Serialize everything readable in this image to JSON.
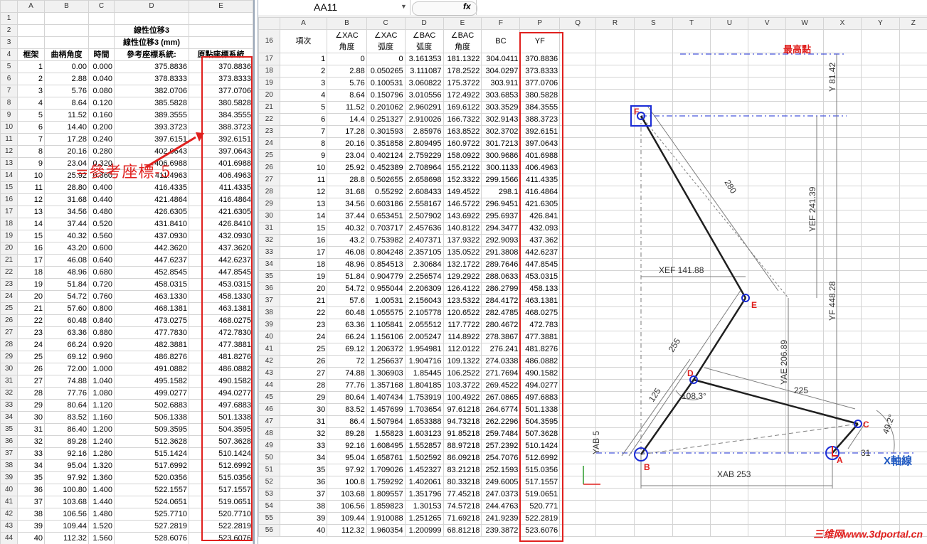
{
  "left_sheet": {
    "col_headers": [
      "A",
      "B",
      "C",
      "D",
      "E"
    ],
    "title1": "線性位移3",
    "title2": "線性位移3 (mm)",
    "headers": [
      "框架",
      "曲柄角度",
      "時間",
      "參考座標系統:",
      "原點座標系統"
    ],
    "row_numbers": [
      "1",
      "2",
      "3",
      "4",
      "5",
      "6",
      "7",
      "8",
      "9",
      "10",
      "11",
      "12",
      "13",
      "14",
      "15",
      "16",
      "17",
      "18",
      "19",
      "20",
      "21",
      "22",
      "23",
      "24",
      "25",
      "26",
      "27",
      "28",
      "29",
      "30",
      "31",
      "32",
      "33",
      "34",
      "35",
      "36",
      "37",
      "38",
      "39",
      "40",
      "41",
      "42",
      "43",
      "44"
    ],
    "rows": [
      [
        "1",
        "0.00",
        "0.000",
        "375.8836",
        "370.8836"
      ],
      [
        "2",
        "2.88",
        "0.040",
        "378.8333",
        "373.8333"
      ],
      [
        "3",
        "5.76",
        "0.080",
        "382.0706",
        "377.0706"
      ],
      [
        "4",
        "8.64",
        "0.120",
        "385.5828",
        "380.5828"
      ],
      [
        "5",
        "11.52",
        "0.160",
        "389.3555",
        "384.3555"
      ],
      [
        "6",
        "14.40",
        "0.200",
        "393.3723",
        "388.3723"
      ],
      [
        "7",
        "17.28",
        "0.240",
        "397.6151",
        "392.6151"
      ],
      [
        "8",
        "20.16",
        "0.280",
        "402.0643",
        "397.0643"
      ],
      [
        "9",
        "23.04",
        "0.320",
        "406.6988",
        "401.6988"
      ],
      [
        "10",
        "25.92",
        "0.360",
        "411.4963",
        "406.4963"
      ],
      [
        "11",
        "28.80",
        "0.400",
        "416.4335",
        "411.4335"
      ],
      [
        "12",
        "31.68",
        "0.440",
        "421.4864",
        "416.4864"
      ],
      [
        "13",
        "34.56",
        "0.480",
        "426.6305",
        "421.6305"
      ],
      [
        "14",
        "37.44",
        "0.520",
        "431.8410",
        "426.8410"
      ],
      [
        "15",
        "40.32",
        "0.560",
        "437.0930",
        "432.0930"
      ],
      [
        "16",
        "43.20",
        "0.600",
        "442.3620",
        "437.3620"
      ],
      [
        "17",
        "46.08",
        "0.640",
        "447.6237",
        "442.6237"
      ],
      [
        "18",
        "48.96",
        "0.680",
        "452.8545",
        "447.8545"
      ],
      [
        "19",
        "51.84",
        "0.720",
        "458.0315",
        "453.0315"
      ],
      [
        "20",
        "54.72",
        "0.760",
        "463.1330",
        "458.1330"
      ],
      [
        "21",
        "57.60",
        "0.800",
        "468.1381",
        "463.1381"
      ],
      [
        "22",
        "60.48",
        "0.840",
        "473.0275",
        "468.0275"
      ],
      [
        "23",
        "63.36",
        "0.880",
        "477.7830",
        "472.7830"
      ],
      [
        "24",
        "66.24",
        "0.920",
        "482.3881",
        "477.3881"
      ],
      [
        "25",
        "69.12",
        "0.960",
        "486.8276",
        "481.8276"
      ],
      [
        "26",
        "72.00",
        "1.000",
        "491.0882",
        "486.0882"
      ],
      [
        "27",
        "74.88",
        "1.040",
        "495.1582",
        "490.1582"
      ],
      [
        "28",
        "77.76",
        "1.080",
        "499.0277",
        "494.0277"
      ],
      [
        "29",
        "80.64",
        "1.120",
        "502.6883",
        "497.6883"
      ],
      [
        "30",
        "83.52",
        "1.160",
        "506.1338",
        "501.1338"
      ],
      [
        "31",
        "86.40",
        "1.200",
        "509.3595",
        "504.3595"
      ],
      [
        "32",
        "89.28",
        "1.240",
        "512.3628",
        "507.3628"
      ],
      [
        "33",
        "92.16",
        "1.280",
        "515.1424",
        "510.1424"
      ],
      [
        "34",
        "95.04",
        "1.320",
        "517.6992",
        "512.6992"
      ],
      [
        "35",
        "97.92",
        "1.360",
        "520.0356",
        "515.0356"
      ],
      [
        "36",
        "100.80",
        "1.400",
        "522.1557",
        "517.1557"
      ],
      [
        "37",
        "103.68",
        "1.440",
        "524.0651",
        "519.0651"
      ],
      [
        "38",
        "106.56",
        "1.480",
        "525.7710",
        "520.7710"
      ],
      [
        "39",
        "109.44",
        "1.520",
        "527.2819",
        "522.2819"
      ],
      [
        "40",
        "112.32",
        "1.560",
        "528.6076",
        "523.6076"
      ]
    ],
    "annotation": "=參考座標-5"
  },
  "formula_bar": {
    "name_box": "AA11",
    "fx": "fx"
  },
  "right_sheet": {
    "col_headers": [
      "A",
      "B",
      "C",
      "D",
      "E",
      "F",
      "P",
      "Q",
      "R",
      "S",
      "T",
      "U",
      "V",
      "W",
      "X",
      "Y",
      "Z"
    ],
    "row_numbers": [
      "16",
      "17",
      "18",
      "19",
      "20",
      "21",
      "22",
      "23",
      "24",
      "25",
      "26",
      "27",
      "28",
      "29",
      "30",
      "31",
      "32",
      "33",
      "34",
      "35",
      "36",
      "37",
      "38",
      "39",
      "40",
      "41",
      "42",
      "43",
      "44",
      "45",
      "46",
      "47",
      "48",
      "49",
      "50",
      "51",
      "52",
      "53",
      "54",
      "55",
      "56"
    ],
    "headers": [
      "項次",
      "∠XAC\n角度",
      "∠XAC\n弧度",
      "∠BAC\n弧度",
      "∠BAC\n角度",
      "BC",
      "YF"
    ],
    "rows": [
      [
        "1",
        "0",
        "0",
        "3.161353",
        "181.1322",
        "304.0411",
        "370.8836"
      ],
      [
        "2",
        "2.88",
        "0.050265",
        "3.111087",
        "178.2522",
        "304.0297",
        "373.8333"
      ],
      [
        "3",
        "5.76",
        "0.100531",
        "3.060822",
        "175.3722",
        "303.911",
        "377.0706"
      ],
      [
        "4",
        "8.64",
        "0.150796",
        "3.010556",
        "172.4922",
        "303.6853",
        "380.5828"
      ],
      [
        "5",
        "11.52",
        "0.201062",
        "2.960291",
        "169.6122",
        "303.3529",
        "384.3555"
      ],
      [
        "6",
        "14.4",
        "0.251327",
        "2.910026",
        "166.7322",
        "302.9143",
        "388.3723"
      ],
      [
        "7",
        "17.28",
        "0.301593",
        "2.85976",
        "163.8522",
        "302.3702",
        "392.6151"
      ],
      [
        "8",
        "20.16",
        "0.351858",
        "2.809495",
        "160.9722",
        "301.7213",
        "397.0643"
      ],
      [
        "9",
        "23.04",
        "0.402124",
        "2.759229",
        "158.0922",
        "300.9686",
        "401.6988"
      ],
      [
        "10",
        "25.92",
        "0.452389",
        "2.708964",
        "155.2122",
        "300.1133",
        "406.4963"
      ],
      [
        "11",
        "28.8",
        "0.502655",
        "2.658698",
        "152.3322",
        "299.1566",
        "411.4335"
      ],
      [
        "12",
        "31.68",
        "0.55292",
        "2.608433",
        "149.4522",
        "298.1",
        "416.4864"
      ],
      [
        "13",
        "34.56",
        "0.603186",
        "2.558167",
        "146.5722",
        "296.9451",
        "421.6305"
      ],
      [
        "14",
        "37.44",
        "0.653451",
        "2.507902",
        "143.6922",
        "295.6937",
        "426.841"
      ],
      [
        "15",
        "40.32",
        "0.703717",
        "2.457636",
        "140.8122",
        "294.3477",
        "432.093"
      ],
      [
        "16",
        "43.2",
        "0.753982",
        "2.407371",
        "137.9322",
        "292.9093",
        "437.362"
      ],
      [
        "17",
        "46.08",
        "0.804248",
        "2.357105",
        "135.0522",
        "291.3808",
        "442.6237"
      ],
      [
        "18",
        "48.96",
        "0.854513",
        "2.30684",
        "132.1722",
        "289.7646",
        "447.8545"
      ],
      [
        "19",
        "51.84",
        "0.904779",
        "2.256574",
        "129.2922",
        "288.0633",
        "453.0315"
      ],
      [
        "20",
        "54.72",
        "0.955044",
        "2.206309",
        "126.4122",
        "286.2799",
        "458.133"
      ],
      [
        "21",
        "57.6",
        "1.00531",
        "2.156043",
        "123.5322",
        "284.4172",
        "463.1381"
      ],
      [
        "22",
        "60.48",
        "1.055575",
        "2.105778",
        "120.6522",
        "282.4785",
        "468.0275"
      ],
      [
        "23",
        "63.36",
        "1.105841",
        "2.055512",
        "117.7722",
        "280.4672",
        "472.783"
      ],
      [
        "24",
        "66.24",
        "1.156106",
        "2.005247",
        "114.8922",
        "278.3867",
        "477.3881"
      ],
      [
        "25",
        "69.12",
        "1.206372",
        "1.954981",
        "112.0122",
        "276.241",
        "481.8276"
      ],
      [
        "26",
        "72",
        "1.256637",
        "1.904716",
        "109.1322",
        "274.0338",
        "486.0882"
      ],
      [
        "27",
        "74.88",
        "1.306903",
        "1.85445",
        "106.2522",
        "271.7694",
        "490.1582"
      ],
      [
        "28",
        "77.76",
        "1.357168",
        "1.804185",
        "103.3722",
        "269.4522",
        "494.0277"
      ],
      [
        "29",
        "80.64",
        "1.407434",
        "1.753919",
        "100.4922",
        "267.0865",
        "497.6883"
      ],
      [
        "30",
        "83.52",
        "1.457699",
        "1.703654",
        "97.61218",
        "264.6774",
        "501.1338"
      ],
      [
        "31",
        "86.4",
        "1.507964",
        "1.653388",
        "94.73218",
        "262.2296",
        "504.3595"
      ],
      [
        "32",
        "89.28",
        "1.55823",
        "1.603123",
        "91.85218",
        "259.7484",
        "507.3628"
      ],
      [
        "33",
        "92.16",
        "1.608495",
        "1.552857",
        "88.97218",
        "257.2392",
        "510.1424"
      ],
      [
        "34",
        "95.04",
        "1.658761",
        "1.502592",
        "86.09218",
        "254.7076",
        "512.6992"
      ],
      [
        "35",
        "97.92",
        "1.709026",
        "1.452327",
        "83.21218",
        "252.1593",
        "515.0356"
      ],
      [
        "36",
        "100.8",
        "1.759292",
        "1.402061",
        "80.33218",
        "249.6005",
        "517.1557"
      ],
      [
        "37",
        "103.68",
        "1.809557",
        "1.351796",
        "77.45218",
        "247.0373",
        "519.0651"
      ],
      [
        "38",
        "106.56",
        "1.859823",
        "1.30153",
        "74.57218",
        "244.4763",
        "520.771"
      ],
      [
        "39",
        "109.44",
        "1.910088",
        "1.251265",
        "71.69218",
        "241.9239",
        "522.2819"
      ],
      [
        "40",
        "112.32",
        "1.960354",
        "1.200999",
        "68.81218",
        "239.3872",
        "523.6076"
      ]
    ]
  },
  "diagram": {
    "top_label": "最高點",
    "x_axis_label": "X軸線",
    "points": [
      "F",
      "E",
      "D",
      "C",
      "B",
      "A"
    ],
    "dims": {
      "y81": "Y 81.42",
      "yef": "YEF 241.39",
      "yf": "YF 448.28",
      "xef": "XEF 141.88",
      "yae": "YAE 206.89",
      "len280": "280",
      "len255": "255",
      "len125": "125",
      "len225": "225",
      "angle108": "108.3°",
      "angle49": "49.2°",
      "len31": "31",
      "yab": "YAB 5",
      "xab": "XAB 253"
    },
    "colors": {
      "red": "#e0201e",
      "blue": "#1a2bd6",
      "dim": "#7d7d7d"
    }
  },
  "watermark": "三维网www.3dportal.cn"
}
